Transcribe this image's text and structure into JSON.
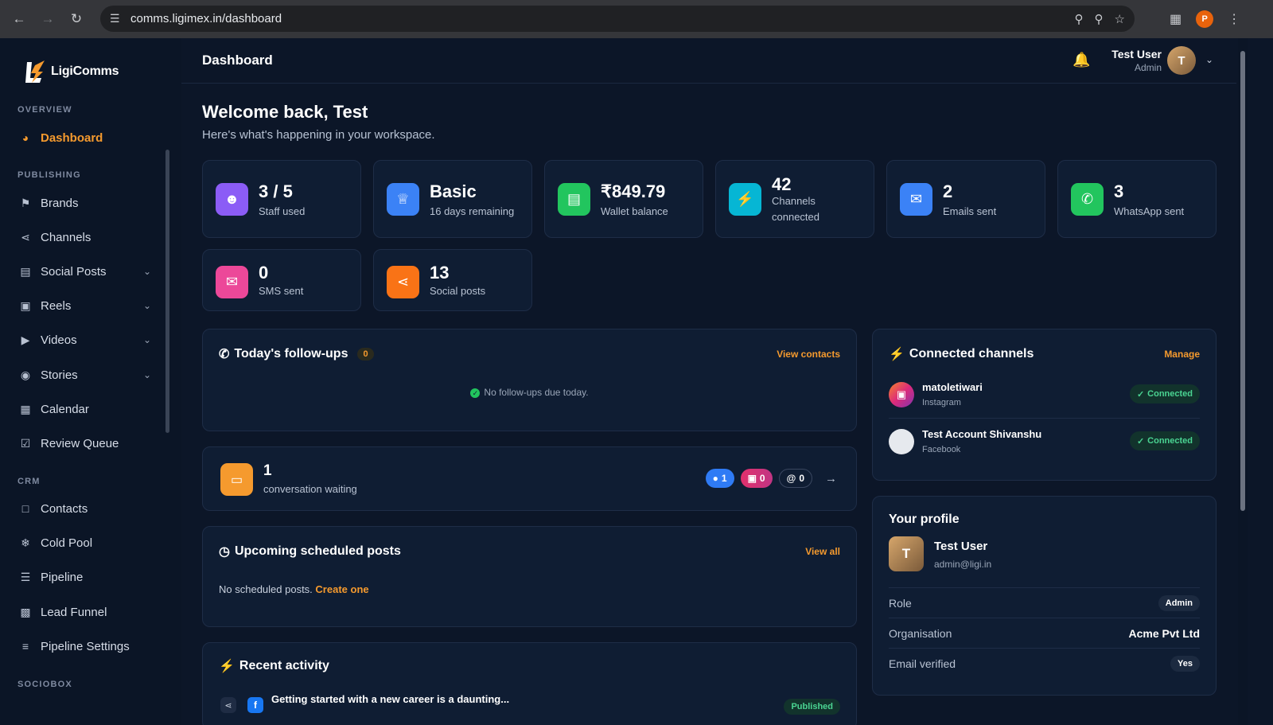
{
  "browser": {
    "url": "comms.ligimex.in/dashboard",
    "profile_initial": "P"
  },
  "brand": {
    "name": "LigiComms"
  },
  "sidebar": {
    "sections": {
      "overview": "OVERVIEW",
      "publishing": "PUBLISHING",
      "crm": "CRM",
      "sociobox": "SOCIOBOX"
    },
    "items": [
      {
        "label": "Dashboard"
      },
      {
        "label": "Brands"
      },
      {
        "label": "Channels"
      },
      {
        "label": "Social Posts"
      },
      {
        "label": "Reels"
      },
      {
        "label": "Videos"
      },
      {
        "label": "Stories"
      },
      {
        "label": "Calendar"
      },
      {
        "label": "Review Queue"
      },
      {
        "label": "Contacts"
      },
      {
        "label": "Cold Pool"
      },
      {
        "label": "Pipeline"
      },
      {
        "label": "Lead Funnel"
      },
      {
        "label": "Pipeline Settings"
      }
    ]
  },
  "header": {
    "title": "Dashboard",
    "user_name": "Test User",
    "user_role": "Admin",
    "user_initial": "T"
  },
  "welcome": {
    "title": "Welcome back, Test",
    "subtitle": "Here's what's happening in your workspace."
  },
  "stats": [
    {
      "value": "3 / 5",
      "label": "Staff used",
      "icon": "users-icon",
      "color": "#8b5cf6"
    },
    {
      "value": "Basic",
      "label": "16 days remaining",
      "icon": "crown-icon",
      "color": "#3b82f6"
    },
    {
      "value": "₹849.79",
      "label": "Wallet balance",
      "icon": "wallet-icon",
      "color": "#22c55e"
    },
    {
      "value": "42",
      "label": "Channels connected",
      "icon": "plug-icon",
      "color": "#06b6d4"
    },
    {
      "value": "2",
      "label": "Emails sent",
      "icon": "envelope-icon",
      "color": "#3b82f6"
    },
    {
      "value": "3",
      "label": "WhatsApp sent",
      "icon": "whatsapp-icon",
      "color": "#22c55e"
    },
    {
      "value": "0",
      "label": "SMS sent",
      "icon": "sms-icon",
      "color": "#ec4899"
    },
    {
      "value": "13",
      "label": "Social posts",
      "icon": "share-icon",
      "color": "#f97316"
    }
  ],
  "followups": {
    "title": "Today's follow-ups",
    "count": "0",
    "link": "View contacts",
    "empty": "No follow-ups due today."
  },
  "conversations": {
    "count": "1",
    "label": "conversation waiting",
    "messenger": "1",
    "instagram": "0",
    "threads": "0"
  },
  "scheduled": {
    "title": "Upcoming scheduled posts",
    "link": "View all",
    "empty": "No scheduled posts.",
    "cta": "Create one"
  },
  "activity": {
    "title": "Recent activity",
    "first_item": "Getting started with a new career is a daunting...",
    "first_status": "Published"
  },
  "channels": {
    "title": "Connected channels",
    "link": "Manage",
    "items": [
      {
        "name": "matoletiwari",
        "platform": "Instagram",
        "status": "Connected"
      },
      {
        "name": "Test Account Shivanshu",
        "platform": "Facebook",
        "status": "Connected"
      }
    ]
  },
  "profile": {
    "title": "Your profile",
    "name": "Test User",
    "email": "admin@ligi.in",
    "initial": "T",
    "rows": [
      {
        "label": "Role",
        "value": "Admin"
      },
      {
        "label": "Organisation",
        "value": "Acme Pvt Ltd"
      },
      {
        "label": "Email verified",
        "value": "Yes"
      }
    ]
  }
}
